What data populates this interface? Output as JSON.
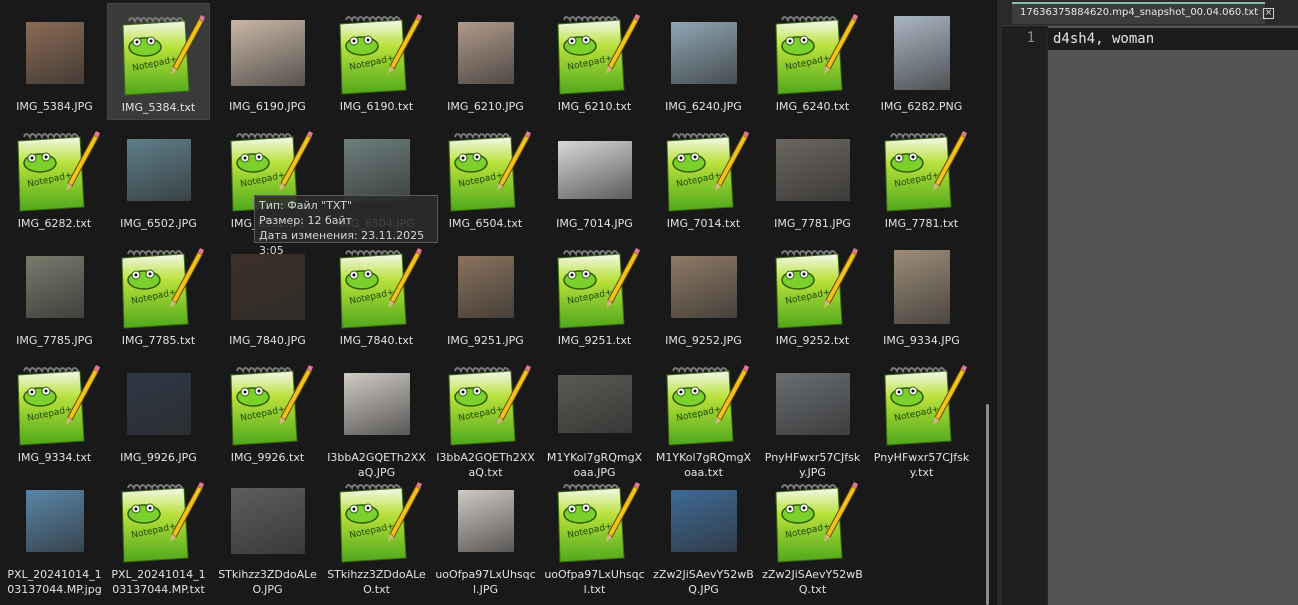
{
  "tooltip": {
    "type": "Тип: Файл \"TXT\"",
    "size": "Размер: 12 байт",
    "date": "Дата изменения: 23.11.2025 3:05"
  },
  "editor": {
    "tab_title": "17636375884620.mp4_snapshot_00.04.060.txt",
    "close_glyph": "×",
    "line_number": "1",
    "content": "d4sh4, woman"
  },
  "files": [
    {
      "name": "IMG_5384.JPG",
      "kind": "photo",
      "color": "#8a6b55"
    },
    {
      "name": "IMG_5384.txt",
      "kind": "txt",
      "selected": true
    },
    {
      "name": "IMG_6190.JPG",
      "kind": "photo",
      "color": "#c9b7a6"
    },
    {
      "name": "IMG_6190.txt",
      "kind": "txt"
    },
    {
      "name": "IMG_6210.JPG",
      "kind": "photo",
      "color": "#b09a8a"
    },
    {
      "name": "IMG_6210.txt",
      "kind": "txt"
    },
    {
      "name": "IMG_6240.JPG",
      "kind": "photo",
      "color": "#8fa6b4"
    },
    {
      "name": "IMG_6240.txt",
      "kind": "txt"
    },
    {
      "name": "IMG_6282.PNG",
      "kind": "photo",
      "color": "#a9b6c2"
    },
    {
      "name": "IMG_6282.txt",
      "kind": "txt"
    },
    {
      "name": "IMG_6502.JPG",
      "kind": "photo",
      "color": "#5f7f8a"
    },
    {
      "name": "IMG_6502.txt",
      "kind": "txt"
    },
    {
      "name": "IMG_6504.JPG",
      "kind": "photo",
      "color": "#6d7f7d"
    },
    {
      "name": "IMG_6504.txt",
      "kind": "txt"
    },
    {
      "name": "IMG_7014.JPG",
      "kind": "photo",
      "color": "#d8d8d8"
    },
    {
      "name": "IMG_7014.txt",
      "kind": "txt"
    },
    {
      "name": "IMG_7781.JPG",
      "kind": "photo",
      "color": "#6b6660"
    },
    {
      "name": "IMG_7781.txt",
      "kind": "txt"
    },
    {
      "name": "IMG_7785.JPG",
      "kind": "photo",
      "color": "#7a7a6c"
    },
    {
      "name": "IMG_7785.txt",
      "kind": "txt"
    },
    {
      "name": "IMG_7840.JPG",
      "kind": "photo",
      "color": "#3d3027"
    },
    {
      "name": "IMG_7840.txt",
      "kind": "txt"
    },
    {
      "name": "IMG_9251.JPG",
      "kind": "photo",
      "color": "#8a735e"
    },
    {
      "name": "IMG_9251.txt",
      "kind": "txt"
    },
    {
      "name": "IMG_9252.JPG",
      "kind": "photo",
      "color": "#8e7a66"
    },
    {
      "name": "IMG_9252.txt",
      "kind": "txt"
    },
    {
      "name": "IMG_9334.JPG",
      "kind": "photo",
      "color": "#9c8d78"
    },
    {
      "name": "IMG_9334.txt",
      "kind": "txt"
    },
    {
      "name": "IMG_9926.JPG",
      "kind": "photo",
      "color": "#2f3846"
    },
    {
      "name": "IMG_9926.txt",
      "kind": "txt"
    },
    {
      "name": "I3bbA2GQETh2XXaQ.JPG",
      "kind": "photo",
      "color": "#cfcac4"
    },
    {
      "name": "I3bbA2GQETh2XXaQ.txt",
      "kind": "txt"
    },
    {
      "name": "M1YKol7gRQmgXoaa.JPG",
      "kind": "photo",
      "color": "#5a5a55"
    },
    {
      "name": "M1YKol7gRQmgXoaa.txt",
      "kind": "txt"
    },
    {
      "name": "PnyHFwxr57CJfsky.JPG",
      "kind": "photo",
      "color": "#6a6e72"
    },
    {
      "name": "PnyHFwxr57CJfsky.txt",
      "kind": "txt"
    },
    {
      "name": "PXL_20241014_103137044.MP.jpg",
      "kind": "photo",
      "color": "#5a86a8"
    },
    {
      "name": "PXL_20241014_103137044.MP.txt",
      "kind": "txt"
    },
    {
      "name": "STkihzz3ZDdoALeO.JPG",
      "kind": "photo",
      "color": "#5e5e5e"
    },
    {
      "name": "STkihzz3ZDdoALeO.txt",
      "kind": "txt"
    },
    {
      "name": "uoOfpa97LxUhsqcl.JPG",
      "kind": "photo",
      "color": "#cfc9c3"
    },
    {
      "name": "uoOfpa97LxUhsqcl.txt",
      "kind": "txt"
    },
    {
      "name": "zZw2JiSAevY52wBQ.JPG",
      "kind": "photo",
      "color": "#3f6a96"
    },
    {
      "name": "zZw2JiSAevY52wBQ.txt",
      "kind": "txt"
    }
  ]
}
